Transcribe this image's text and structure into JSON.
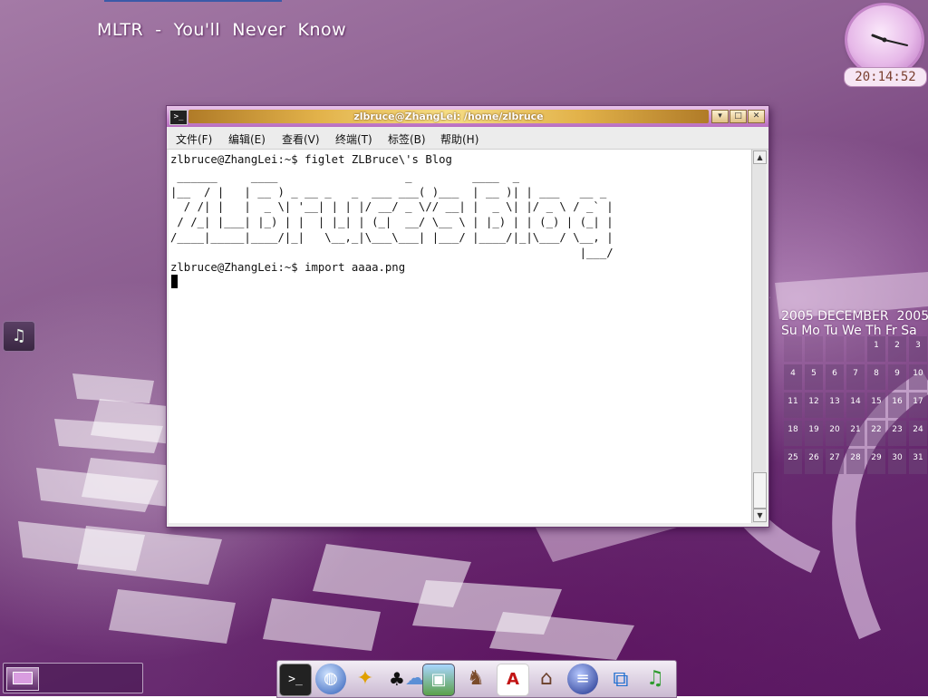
{
  "desktop": {
    "now_playing": "MLTR  -  You'll  Never  Know",
    "clock": {
      "time": "20:14:52"
    }
  },
  "terminal": {
    "title": "zlbruce@ZhangLei: /home/zlbruce",
    "menu": [
      "文件(F)",
      "编辑(E)",
      "查看(V)",
      "终端(T)",
      "标签(B)",
      "帮助(H)"
    ],
    "prompt_1": "zlbruce@ZhangLei:~$ figlet ZLBruce\\'s Blog",
    "figlet_output": " ______     ____                   _         ____  _\n|__  / |   | __ ) _ __ _   _  ___ ___( )___  | __ )| | ___   __ _\n  / /| |   |  _ \\| '__| | | |/ __/ _ \\// __| |  _ \\| |/ _ \\ / _` |\n / /_| |___| |_) | |  | |_| | (_|  __/ \\__ \\ | |_) | | (_) | (_| |\n/____|_____|____/|_|   \\__,_|\\___\\___| |___/ |____/|_|\\___/ \\__, |\n                                                             |___/",
    "prompt_2": "zlbruce@ZhangLei:~$ import aaaa.png"
  },
  "calendar": {
    "header": "2005 DECEMBER  2005",
    "weekdays": "Su Mo Tu We Th Fr Sa",
    "weeks": [
      [
        "",
        "",
        "",
        "",
        "1",
        "2",
        "3"
      ],
      [
        "4",
        "5",
        "6",
        "7",
        "8",
        "9",
        "10"
      ],
      [
        "11",
        "12",
        "13",
        "14",
        "15",
        "16",
        "17"
      ],
      [
        "18",
        "19",
        "20",
        "21",
        "22",
        "23",
        "24"
      ],
      [
        "25",
        "26",
        "27",
        "28",
        "29",
        "30",
        "31"
      ]
    ]
  },
  "dock": {
    "icons": [
      "terminal-icon",
      "globe-browser-icon",
      "aim-messenger-icon",
      "penguin-icon",
      "chat-bubble-icon",
      "image-viewer-icon",
      "donkey-p2p-icon",
      "pdf-reader-icon",
      "home-folder-icon",
      "sphere-icon",
      "windows-icon",
      "music-player-icon"
    ]
  },
  "colors": {
    "accent": "#b86dc0",
    "terminal_bg": "#ffffff",
    "title_bar": "#cf95d4"
  }
}
